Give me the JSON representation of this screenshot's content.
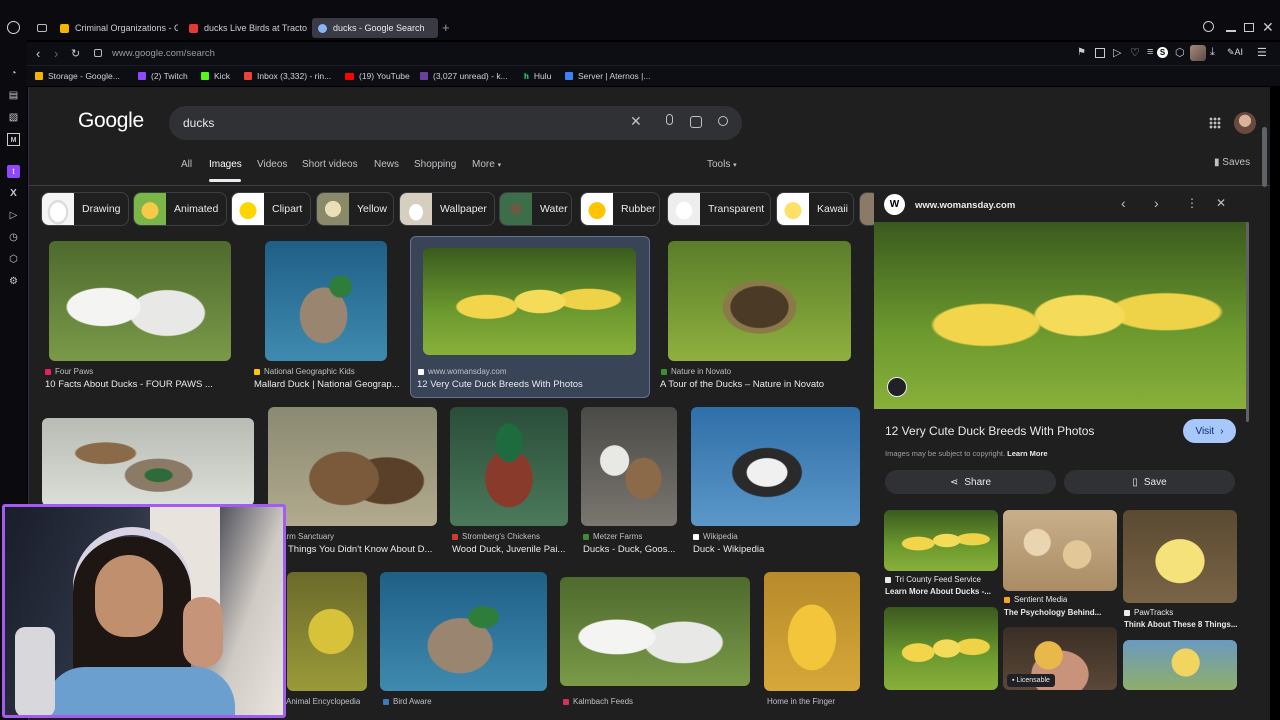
{
  "browser": {
    "tabs": [
      {
        "label": "Criminal Organizations - G",
        "color": "#f4b400"
      },
      {
        "label": "ducks Live Birds at Tracto",
        "color": "#e53935"
      },
      {
        "label": "ducks - Google Search",
        "color": "#8ab4f8",
        "active": true
      }
    ],
    "url": "www.google.com/search",
    "bookmarks": [
      {
        "label": "Storage - Google...",
        "color": "#f4b400"
      },
      {
        "label": "(2) Twitch",
        "color": "#9146ff"
      },
      {
        "label": "Kick",
        "color": "#53fc18"
      },
      {
        "label": "Inbox (3,332) - rin...",
        "color": "#ea4335"
      },
      {
        "label": "(19) YouTube",
        "color": "#ff0000"
      },
      {
        "label": "(3,027 unread) - k...",
        "color": "#6b3fa0"
      },
      {
        "label": "Hulu",
        "color": "#1ce783"
      },
      {
        "label": "Server | Aternos |...",
        "color": "#3b82f6"
      }
    ],
    "ai_label": "AI"
  },
  "google": {
    "logo": "Google",
    "query": "ducks",
    "nav_tabs": [
      "All",
      "Images",
      "Videos",
      "Short videos",
      "News",
      "Shopping",
      "More"
    ],
    "active_tab": "Images",
    "tools_label": "Tools",
    "saves_label": "Saves",
    "chips": [
      "Drawing",
      "Animated",
      "Clipart",
      "Yellow",
      "Wallpaper",
      "Water",
      "Rubber",
      "Transparent",
      "Kawaii"
    ]
  },
  "results": {
    "row1": [
      {
        "source": "Four Paws",
        "title": "10 Facts About Ducks - FOUR PAWS ..."
      },
      {
        "source": "National Geographic Kids",
        "title": "Mallard Duck | National Geograp..."
      },
      {
        "source": "www.womansday.com",
        "title": "12 Very Cute Duck Breeds With Photos"
      },
      {
        "source": "Nature in Novato",
        "title": "A Tour of the Ducks – Nature in Novato"
      }
    ],
    "row2": [
      {
        "source": "arm Sanctuary",
        "title": "Things You Didn't Know About D..."
      },
      {
        "source": "Stromberg's Chickens",
        "title": "Wood Duck, Juvenile Pai..."
      },
      {
        "source": "Metzer Farms",
        "title": "Ducks - Duck, Goos..."
      },
      {
        "source": "Wikipedia",
        "title": "Duck - Wikipedia"
      }
    ],
    "row3": [
      {
        "source": "Animal Encyclopedia"
      },
      {
        "source": "Bird Aware"
      },
      {
        "source": "Kalmbach Feeds"
      },
      {
        "source": "Home in the Finger"
      }
    ]
  },
  "panel": {
    "site": "www.womansday.com",
    "title": "12 Very Cute Duck Breeds With Photos",
    "visit_label": "Visit",
    "copyright_note": "Images may be subject to copyright.",
    "learn_more": "Learn More",
    "share_label": "Share",
    "save_label": "Save",
    "related": [
      {
        "source": "Tri County Feed Service",
        "title": "Learn More About Ducks -..."
      },
      {
        "source": "Sentient Media",
        "title": "The Psychology Behind..."
      },
      {
        "source": "PawTracks",
        "title": "Think About These 8 Things..."
      }
    ],
    "licensable_label": "Licensable"
  }
}
